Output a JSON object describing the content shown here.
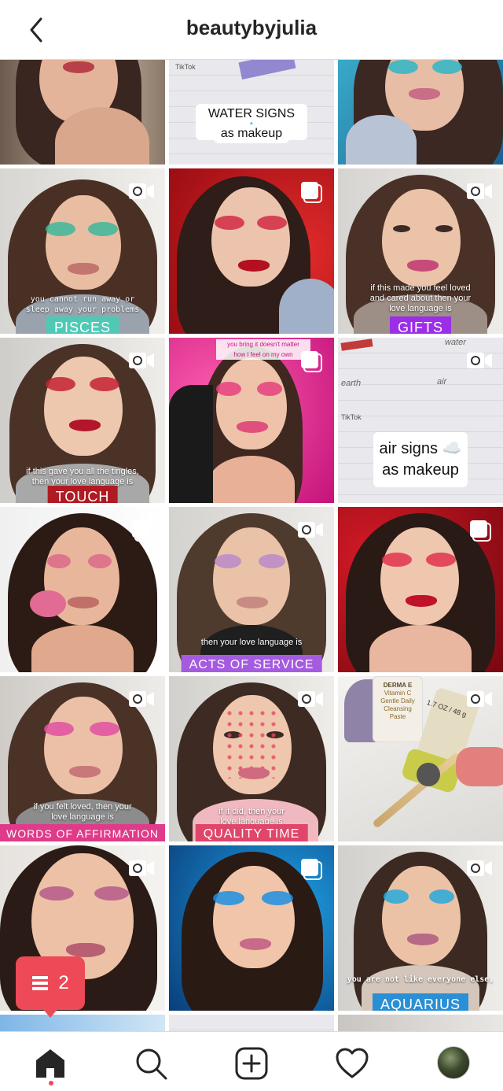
{
  "header": {
    "username": "beautybyjulia"
  },
  "colors": {
    "accent": "#ed4956",
    "text": "#262626",
    "divider": "#dbdbdb"
  },
  "tiles": [
    {
      "type": "photo"
    },
    {
      "type": "tiktok",
      "brand": "TikTok",
      "sticker": [
        "WATER SIGNS 💧",
        "as makeup"
      ]
    },
    {
      "type": "photo"
    },
    {
      "type": "video",
      "caption": [
        "you cannot run away or",
        "sleep away your problems"
      ],
      "banner": "PISCES"
    },
    {
      "type": "carousel"
    },
    {
      "type": "video",
      "caption": [
        "if this made you feel loved",
        "and cared about then your",
        "love language is"
      ],
      "banner": "GIFTS"
    },
    {
      "type": "video",
      "caption": [
        "if this gave you all the tingles,",
        "then your love language is"
      ],
      "banner": "TOUCH"
    },
    {
      "type": "carousel",
      "caption": [
        "you bring it doesn't matter",
        "how I feel on my own"
      ]
    },
    {
      "type": "video",
      "brand": "TikTok",
      "sticker": [
        "air signs ☁️",
        "as makeup"
      ],
      "notes": [
        "water",
        "earth",
        "air"
      ]
    },
    {
      "type": "carousel"
    },
    {
      "type": "video",
      "caption": [
        "then your love language is"
      ],
      "banner": "ACTS OF SERVICE"
    },
    {
      "type": "carousel"
    },
    {
      "type": "video",
      "caption": [
        "if you felt loved, then your",
        "love language is"
      ],
      "banner": "WORDS OF AFFIRMATION"
    },
    {
      "type": "video",
      "caption": [
        "if it did, then your",
        "love language is"
      ],
      "banner": "QUALITY TIME"
    },
    {
      "type": "video",
      "product": [
        "DERMA E",
        "Vitamin C",
        "Gentle Daily",
        "Cleansing Paste",
        "1.7 OZ / 48 g"
      ]
    },
    {
      "type": "video"
    },
    {
      "type": "carousel"
    },
    {
      "type": "video",
      "caption": [
        "you are not like everyone else,"
      ],
      "banner": "AQUARIUS"
    }
  ],
  "notification": {
    "count": "2",
    "icon": "posts-icon"
  },
  "bottom_nav": [
    {
      "name": "home",
      "icon": "home-icon",
      "active": true
    },
    {
      "name": "search",
      "icon": "search-icon"
    },
    {
      "name": "new-post",
      "icon": "add-post-icon"
    },
    {
      "name": "activity",
      "icon": "heart-icon"
    },
    {
      "name": "profile",
      "icon": "profile-avatar"
    }
  ]
}
